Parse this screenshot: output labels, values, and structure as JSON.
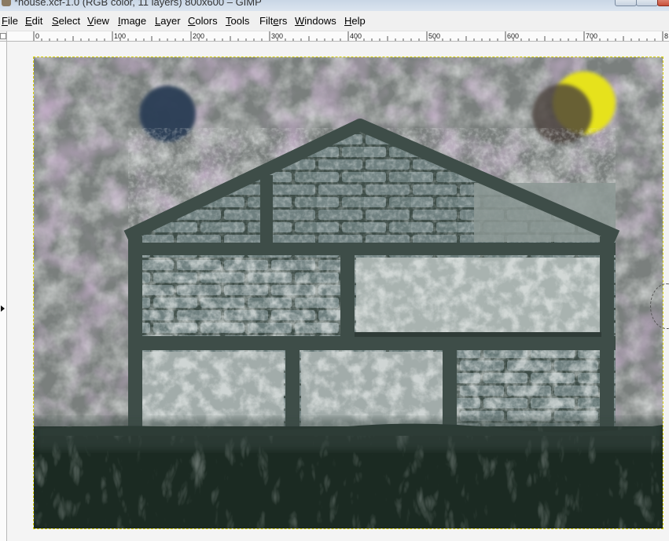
{
  "window": {
    "title": "*house.xcf-1.0 (RGB color, 11 layers) 800x600 – GIMP"
  },
  "menu": [
    {
      "pre": "",
      "mn": "F",
      "post": "ile"
    },
    {
      "pre": "",
      "mn": "E",
      "post": "dit"
    },
    {
      "pre": "",
      "mn": "S",
      "post": "elect"
    },
    {
      "pre": "",
      "mn": "V",
      "post": "iew"
    },
    {
      "pre": "",
      "mn": "I",
      "post": "mage"
    },
    {
      "pre": "",
      "mn": "L",
      "post": "ayer"
    },
    {
      "pre": "",
      "mn": "C",
      "post": "olors"
    },
    {
      "pre": "",
      "mn": "T",
      "post": "ools"
    },
    {
      "pre": "Filt",
      "mn": "e",
      "post": "rs"
    },
    {
      "pre": "",
      "mn": "W",
      "post": "indows"
    },
    {
      "pre": "",
      "mn": "H",
      "post": "elp"
    }
  ],
  "ruler": {
    "labels": [
      "0",
      "100",
      "200",
      "300",
      "400",
      "500",
      "600",
      "700",
      "8"
    ]
  },
  "image": {
    "width": 800,
    "height": 600,
    "colors": {
      "sky": "#7a7f7d",
      "ground": "#1b2a22",
      "frame": "#3e4d48",
      "brick": "#6f8080",
      "window": "#a9b3b0",
      "sun": "#e6e21c",
      "moon": "#2c3d55",
      "haze": "#9a6fa3",
      "layer_boundary": "#d8d000"
    }
  }
}
